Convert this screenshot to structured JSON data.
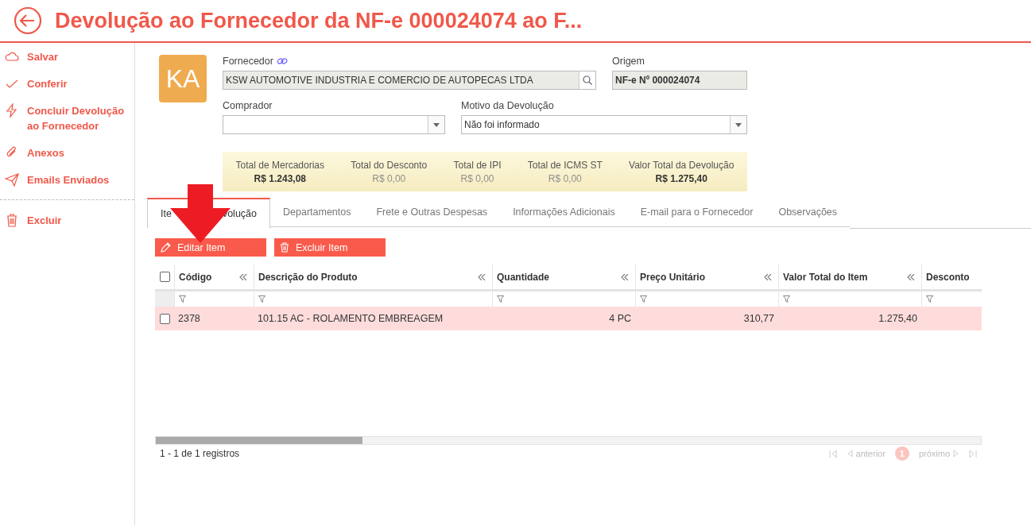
{
  "title": "Devolução ao Fornecedor da NF-e 000024074 ao F...",
  "sidebar": [
    {
      "kind": "cloud",
      "label": "Salvar"
    },
    {
      "kind": "check",
      "label": "Conferir"
    },
    {
      "kind": "bolt",
      "label": "Concluir Devolução ao Fornecedor"
    },
    {
      "kind": "clip",
      "label": "Anexos"
    },
    {
      "kind": "send",
      "label": "Emails Enviados"
    },
    {
      "kind": "trash",
      "label": "Excluir"
    }
  ],
  "avatar": "KA",
  "fornecedor": {
    "label": "Fornecedor",
    "value": "KSW AUTOMOTIVE INDUSTRIA E COMERCIO DE AUTOPECAS LTDA"
  },
  "origem": {
    "label": "Origem",
    "value": "NF-e Nº 000024074"
  },
  "comprador": {
    "label": "Comprador"
  },
  "motivo": {
    "label": "Motivo da Devolução",
    "value": "Não foi informado"
  },
  "totals": [
    {
      "label": "Total de Mercadorias",
      "value": "R$ 1.243,08",
      "zero": false
    },
    {
      "label": "Total do Desconto",
      "value": "R$ 0,00",
      "zero": true
    },
    {
      "label": "Total de IPI",
      "value": "R$ 0,00",
      "zero": true
    },
    {
      "label": "Total de ICMS ST",
      "value": "R$ 0,00",
      "zero": true
    },
    {
      "label": "Valor Total da Devolução",
      "value": "R$ 1.275,40",
      "zero": false
    }
  ],
  "tabs": [
    {
      "parts": [
        "Ite",
        "volução"
      ],
      "selected": true
    },
    {
      "parts": [
        "Departamentos"
      ],
      "selected": false
    },
    {
      "parts": [
        "Frete e Outras Despesas"
      ],
      "selected": false
    },
    {
      "parts": [
        "Informações Adicionais"
      ],
      "selected": false
    },
    {
      "parts": [
        "E-mail para o Fornecedor"
      ],
      "selected": false
    },
    {
      "parts": [
        "Observações"
      ],
      "selected": false
    }
  ],
  "actions": [
    {
      "kind": "pencil",
      "label": "Editar Item"
    },
    {
      "kind": "trash",
      "label": "Excluir Item"
    }
  ],
  "table": {
    "all_checked": false,
    "columns": [
      "Código",
      "Descrição do Produto",
      "Quantidade",
      "Preço Unitário",
      "Valor Total do Item",
      "Desconto"
    ],
    "rows": [
      {
        "checked": false,
        "cells": [
          "2378",
          "101.15 AC - ROLAMENTO EMBREAGEM",
          "4 PC",
          "310,77",
          "1.275,40",
          ""
        ]
      }
    ]
  },
  "pager": {
    "summary": "1 - 1 de 1 registros",
    "prev": "anterior",
    "page": "1",
    "next": "próximo"
  }
}
